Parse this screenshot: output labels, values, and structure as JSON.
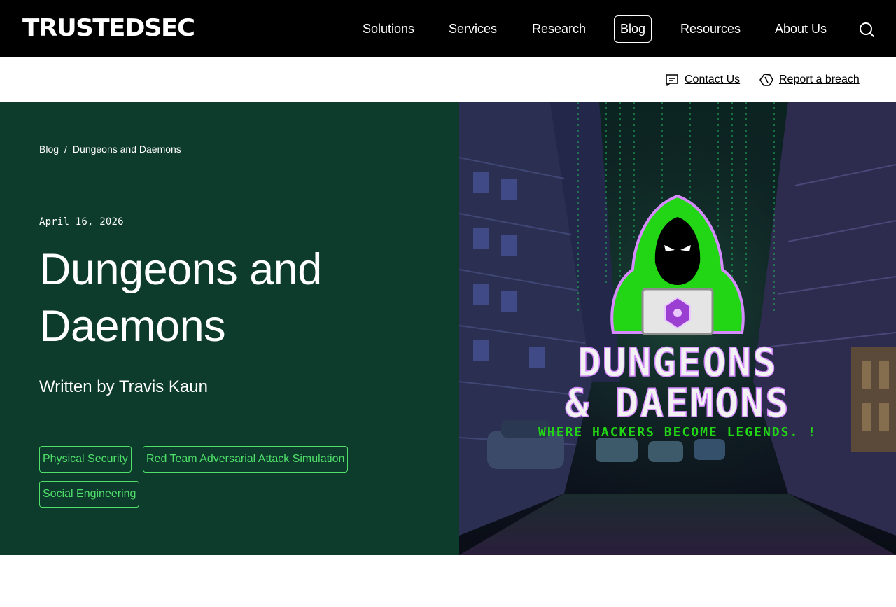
{
  "header": {
    "logo": "TRUSTEDSEC",
    "nav": [
      {
        "label": "Solutions",
        "active": false
      },
      {
        "label": "Services",
        "active": false
      },
      {
        "label": "Research",
        "active": false
      },
      {
        "label": "Blog",
        "active": true
      },
      {
        "label": "Resources",
        "active": false
      },
      {
        "label": "About Us",
        "active": false
      }
    ],
    "search_icon": "search-icon"
  },
  "utility": {
    "contact_label": "Contact Us",
    "contact_icon": "chat-icon",
    "breach_label": "Report a breach",
    "breach_icon": "alert-hexagon-icon"
  },
  "breadcrumb": {
    "items": [
      "Blog",
      "Dungeons and Daemons"
    ],
    "separator": "/"
  },
  "post": {
    "date": "April 16, 2026",
    "title_line1": "Dungeons and",
    "title_line2": "Daemons",
    "author": "Written by Travis Kaun",
    "tags": [
      "Physical Security",
      "Red Team Adversarial Attack Simulation",
      "Social Engineering"
    ]
  },
  "hero_image": {
    "headline_line1": "DUNGEONS",
    "headline_line2": "& DAEMONS",
    "tagline": "WHERE HACKERS BECOME LEGENDS. !"
  },
  "colors": {
    "header_bg": "#000000",
    "hero_bg": "#0d3b2c",
    "tag_accent": "#4fe06a",
    "hacker_green": "#22d615"
  }
}
